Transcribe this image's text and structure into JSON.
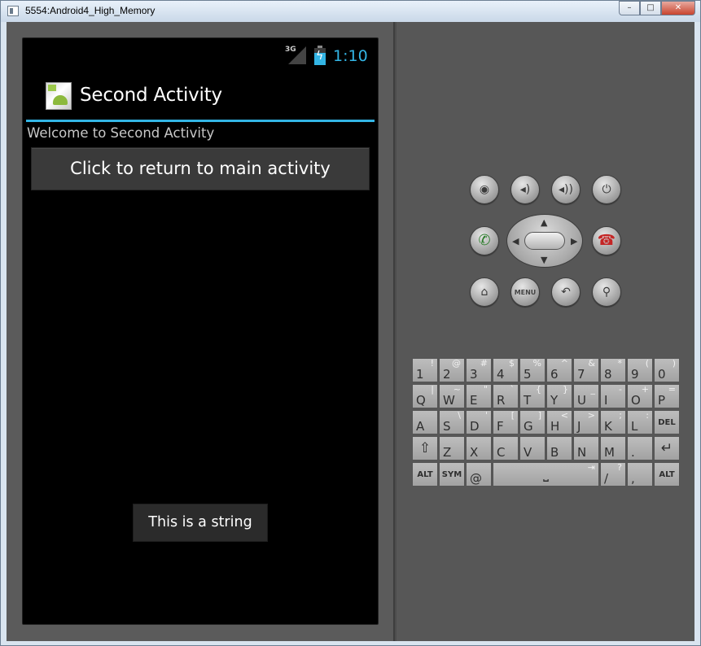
{
  "window": {
    "title": "5554:Android4_High_Memory",
    "controls": {
      "minimize": "–",
      "maximize": "□",
      "close": "✕"
    }
  },
  "statusbar": {
    "network": "3G",
    "time": "1:10",
    "battery_icon": "battery-charging-icon",
    "accent_color": "#33b5e5"
  },
  "actionbar": {
    "title": "Second Activity"
  },
  "content": {
    "welcome": "Welcome to Second Activity",
    "button_label": "Click to return to main activity"
  },
  "toast": {
    "text": "This is a string"
  },
  "hardware": {
    "dpad": {
      "up": "▲",
      "down": "▼",
      "left": "◀",
      "right": "▶"
    },
    "buttons": [
      {
        "name": "camera-icon",
        "glyph": "📷"
      },
      {
        "name": "volume-down-icon",
        "glyph": "🔉"
      },
      {
        "name": "volume-up-icon",
        "glyph": "🔊"
      },
      {
        "name": "power-icon",
        "glyph": "⏻"
      },
      {
        "name": "call-icon",
        "glyph": "✆"
      },
      {
        "name": "end-call-icon",
        "glyph": "☎"
      },
      {
        "name": "home-icon",
        "glyph": "⌂"
      },
      {
        "name": "menu-label",
        "glyph": "MENU"
      },
      {
        "name": "back-icon",
        "glyph": "↶"
      },
      {
        "name": "search-icon",
        "glyph": "🔍"
      }
    ]
  },
  "keyboard": {
    "row1": [
      {
        "m": "1",
        "s": "!"
      },
      {
        "m": "2",
        "s": "@"
      },
      {
        "m": "3",
        "s": "#"
      },
      {
        "m": "4",
        "s": "$"
      },
      {
        "m": "5",
        "s": "%"
      },
      {
        "m": "6",
        "s": "^"
      },
      {
        "m": "7",
        "s": "&"
      },
      {
        "m": "8",
        "s": "*"
      },
      {
        "m": "9",
        "s": "("
      },
      {
        "m": "0",
        "s": ")"
      }
    ],
    "row2": [
      {
        "m": "Q",
        "s": "|"
      },
      {
        "m": "W",
        "s": "~"
      },
      {
        "m": "E",
        "s": "\""
      },
      {
        "m": "R",
        "s": "`"
      },
      {
        "m": "T",
        "s": "{"
      },
      {
        "m": "Y",
        "s": "}"
      },
      {
        "m": "U",
        "s": "_"
      },
      {
        "m": "I",
        "s": "-"
      },
      {
        "m": "O",
        "s": "+"
      },
      {
        "m": "P",
        "s": "="
      }
    ],
    "row3": [
      {
        "m": "A",
        "s": ""
      },
      {
        "m": "S",
        "s": "\\"
      },
      {
        "m": "D",
        "s": "'"
      },
      {
        "m": "F",
        "s": "["
      },
      {
        "m": "G",
        "s": "]"
      },
      {
        "m": "H",
        "s": "<"
      },
      {
        "m": "J",
        "s": ">"
      },
      {
        "m": "K",
        "s": ";"
      },
      {
        "m": "L",
        "s": ":"
      },
      {
        "m": "DEL",
        "s": ""
      }
    ],
    "row4": [
      {
        "m": "⇧",
        "s": ""
      },
      {
        "m": "Z",
        "s": ""
      },
      {
        "m": "X",
        "s": ""
      },
      {
        "m": "C",
        "s": ""
      },
      {
        "m": "V",
        "s": ""
      },
      {
        "m": "B",
        "s": ""
      },
      {
        "m": "N",
        "s": ""
      },
      {
        "m": "M",
        "s": ""
      },
      {
        "m": ".",
        "s": ""
      },
      {
        "m": "↵",
        "s": ""
      }
    ],
    "row5": [
      {
        "m": "ALT",
        "s": ""
      },
      {
        "m": "SYM",
        "s": ""
      },
      {
        "m": "@",
        "s": ""
      },
      {
        "m": "⎵",
        "s": "⇥"
      },
      {
        "m": "/",
        "s": "?"
      },
      {
        "m": ",",
        "s": ""
      },
      {
        "m": "ALT",
        "s": ""
      }
    ]
  }
}
